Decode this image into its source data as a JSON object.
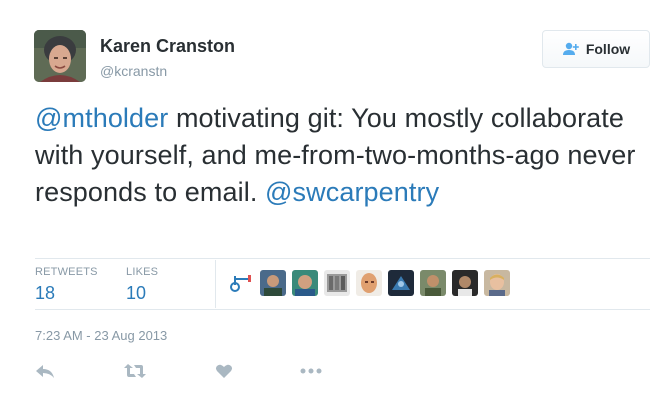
{
  "author": {
    "name": "Karen Cranston",
    "handle": "@kcranstn",
    "avatar_icon": "user-avatar-photo"
  },
  "follow_button": {
    "label": "Follow",
    "icon": "add-user-icon"
  },
  "tweet": {
    "mention_1": "@mtholder",
    "text": " motivating git: You mostly collaborate with yourself, and me-from-two-months-ago never responds to email. ",
    "mention_2": "@swcarpentry"
  },
  "stats": {
    "retweets_label": "RETWEETS",
    "retweets_value": "18",
    "likes_label": "LIKES",
    "likes_value": "10"
  },
  "favoriters": [
    "favoriter-1-avatar",
    "favoriter-2-avatar",
    "favoriter-3-avatar",
    "favoriter-4-avatar",
    "favoriter-5-avatar",
    "favoriter-6-avatar",
    "favoriter-7-avatar",
    "favoriter-8-avatar",
    "favoriter-9-avatar",
    "favoriter-10-avatar"
  ],
  "timestamp": "7:23 AM - 23 Aug 2013",
  "actions": [
    "reply-icon",
    "retweet-icon",
    "like-icon",
    "more-icon"
  ],
  "colors": {
    "link": "#2b7bb9",
    "muted": "#8899a6",
    "text": "#292f33",
    "border": "#e1e8ed"
  }
}
